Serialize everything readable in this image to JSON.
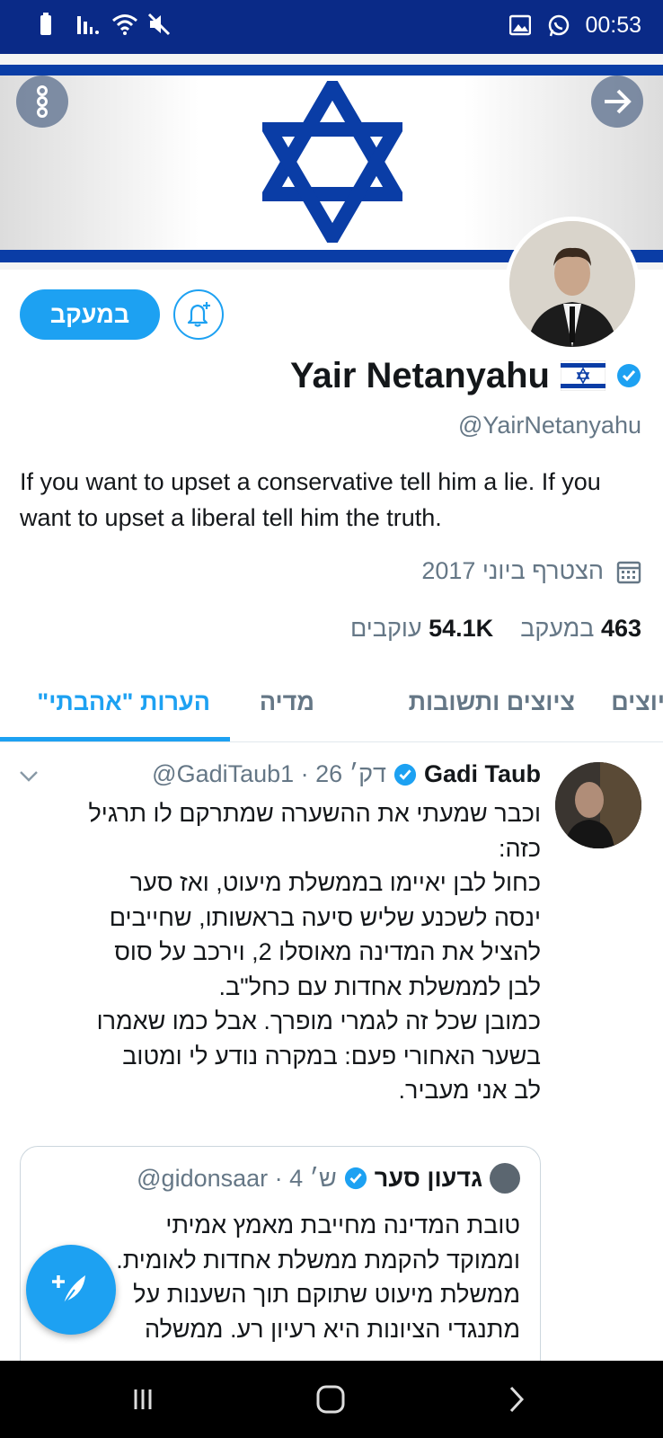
{
  "status_bar": {
    "time": "00:53",
    "icons": [
      "battery-icon",
      "signal-icon",
      "wifi-icon",
      "mute-icon",
      "gallery-icon",
      "whatsapp-icon"
    ]
  },
  "banner": {
    "menu_icon": "more-vertical-icon",
    "forward_icon": "arrow-right-icon"
  },
  "profile": {
    "follow_label": "במעקב",
    "name": "Yair Netanyahu",
    "handle": "@YairNetanyahu",
    "bio": "If you want to upset a conservative tell him a lie. If you want to upset a liberal tell him the truth.",
    "joined": "הצטרף ביוני 2017",
    "following_count": "463",
    "following_label": "במעקב",
    "followers_count": "54.1K",
    "followers_label": "עוקבים"
  },
  "tabs": [
    {
      "label": "יוצים",
      "active": false
    },
    {
      "label": "ציוצים ותשובות",
      "active": false
    },
    {
      "label": "מדיה",
      "active": false
    },
    {
      "label": "הערות \"אהבתי\"",
      "active": true
    }
  ],
  "tweet": {
    "author": "Gadi Taub",
    "meta": "@GadiTaub1 · 26 דק׳",
    "text": "וכבר שמעתי את ההשערה שמתרקם לו תרגיל\nכזה:\nכחול לבן יאיימו בממשלת מיעוט, ואז סער\nינסה לשכנע שליש סיעה בראשותו, שחייבים\nלהציל את המדינה מאוסלו 2, וירכב על סוס\nלבן לממשלת אחדות עם כחל\"ב.\nכמובן שכל זה לגמרי מופרך. אבל כמו שאמרו\nבשער האחורי פעם: במקרה נודע לי ומטוב\nלב אני מעביר."
  },
  "quoted_tweet": {
    "author": "גדעון סער",
    "meta": "@gidonsaar · 4 ש׳",
    "text": "טובת המדינה מחייבת מאמץ אמיתי\nוממוקד להקמת ממשלת אחדות לאומית.\nממשלת מיעוט שתוקם תוך השענות על\nמתנגדי הציונות היא רעיון רע. ממשלה"
  },
  "fab": {
    "icon": "compose-tweet-icon"
  },
  "nav_bar": {
    "icons": [
      "recent-apps-icon",
      "home-icon",
      "back-icon"
    ]
  },
  "colors": {
    "accent": "#1da1f2",
    "status_bar": "#0a2a87",
    "flag_blue": "#0a3da6"
  }
}
